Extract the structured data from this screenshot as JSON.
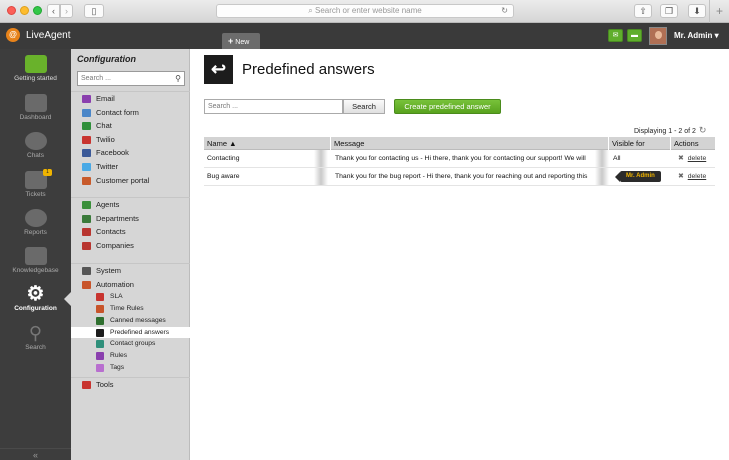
{
  "browser": {
    "address_placeholder": "Search or enter website name"
  },
  "app": {
    "name": "LiveAgent",
    "new_tab_label": "New",
    "user_name": "Mr. Admin"
  },
  "left_nav": [
    {
      "label": "Getting started",
      "icon": "getting-started-icon"
    },
    {
      "label": "Dashboard",
      "icon": "dashboard-icon"
    },
    {
      "label": "Chats",
      "icon": "chat-bubble-icon"
    },
    {
      "label": "Tickets",
      "icon": "envelope-icon",
      "badge": "1"
    },
    {
      "label": "Reports",
      "icon": "pie-chart-icon"
    },
    {
      "label": "Knowledgebase",
      "icon": "book-icon"
    },
    {
      "label": "Configuration",
      "icon": "gear-icon",
      "active": true
    },
    {
      "label": "Search",
      "icon": "magnifier-icon"
    }
  ],
  "config": {
    "heading": "Configuration",
    "search_placeholder": "Search ...",
    "channels": [
      {
        "label": "Email",
        "color": "#8a3fae"
      },
      {
        "label": "Contact form",
        "color": "#4a86c8"
      },
      {
        "label": "Chat",
        "color": "#2f8f3a"
      },
      {
        "label": "Twilio",
        "color": "#c8342f"
      },
      {
        "label": "Facebook",
        "color": "#3b5998"
      },
      {
        "label": "Twitter",
        "color": "#48a9e6"
      },
      {
        "label": "Customer portal",
        "color": "#c85a2a"
      }
    ],
    "people": [
      {
        "label": "Agents",
        "color": "#3a8f3a"
      },
      {
        "label": "Departments",
        "color": "#3a7a3a"
      },
      {
        "label": "Contacts",
        "color": "#b8352f"
      },
      {
        "label": "Companies",
        "color": "#b8352f"
      }
    ],
    "system": [
      {
        "label": "System",
        "color": "#555555"
      },
      {
        "label": "Automation",
        "color": "#c8542a"
      }
    ],
    "automation_items": [
      {
        "label": "SLA",
        "color": "#c8342f"
      },
      {
        "label": "Time Rules",
        "color": "#c8542a"
      },
      {
        "label": "Canned messages",
        "color": "#2f6f2f"
      },
      {
        "label": "Predefined answers",
        "color": "#1c1c1c",
        "selected": true
      },
      {
        "label": "Contact groups",
        "color": "#2f8f7a"
      },
      {
        "label": "Rules",
        "color": "#8a3fae"
      },
      {
        "label": "Tags",
        "color": "#b86fcf"
      }
    ],
    "tools": {
      "label": "Tools",
      "color": "#c8342f"
    }
  },
  "main": {
    "title": "Predefined answers",
    "search_placeholder": "Search ...",
    "search_button": "Search",
    "create_button": "Create predefined answer",
    "paging": "Displaying 1 - 2 of 2",
    "columns": [
      "Name",
      "Message",
      "Visible for",
      "Actions"
    ],
    "rows": [
      {
        "name": "Contacting",
        "message": "Thank you for contacting us - Hi there, thank you for contacting our support! We will",
        "visible_for": "All",
        "action": "delete"
      },
      {
        "name": "Bug aware",
        "message": "Thank you for the bug report - Hi there, thank you for reaching out and reporting this",
        "visible_for": "",
        "action": "delete"
      }
    ],
    "tooltip": "Mr. Admin"
  }
}
